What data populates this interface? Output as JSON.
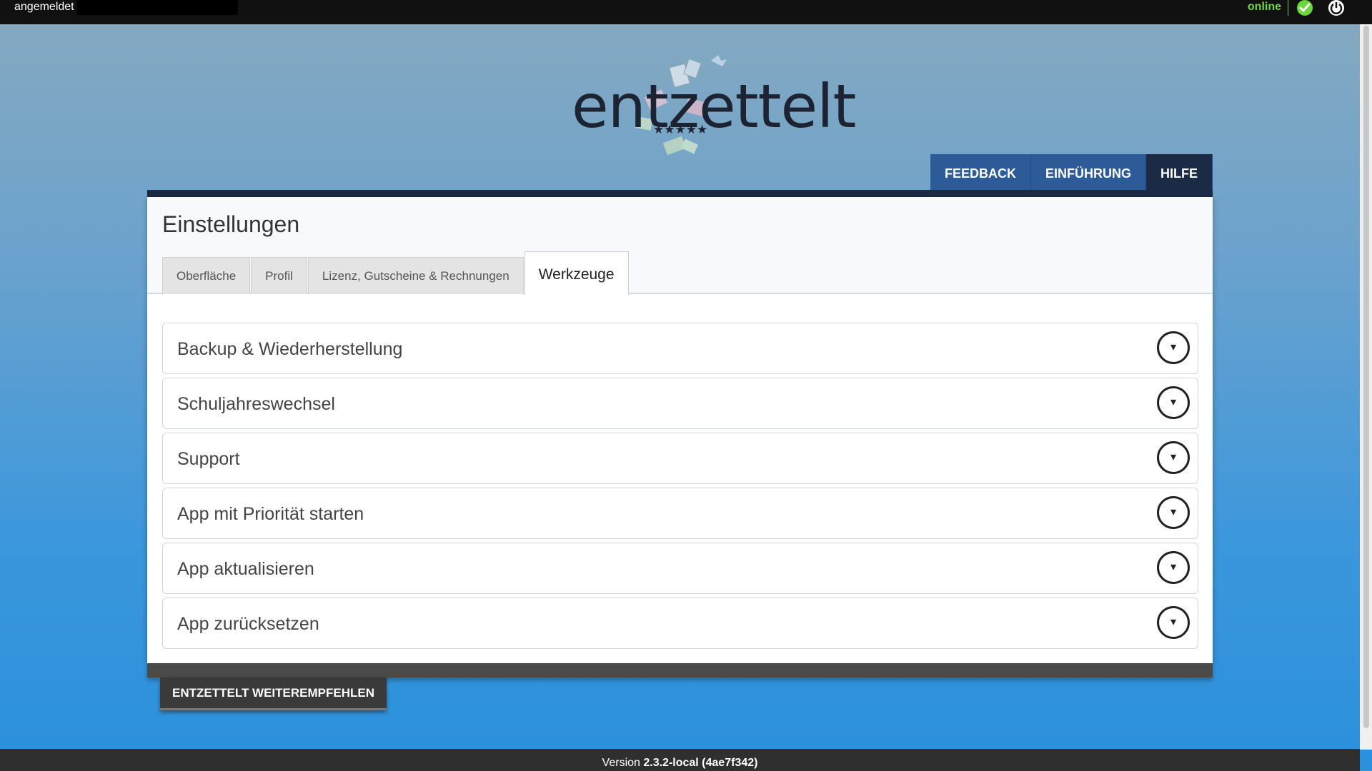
{
  "topbar": {
    "user_status": "angemeldet",
    "connection": "online",
    "check_icon": "check-circle-icon",
    "power_icon": "power-icon",
    "status_color": "#6bd63e"
  },
  "logo": {
    "text": "entzettelt",
    "stars": "★★★★★"
  },
  "nav": {
    "tabs": [
      {
        "label": "FEEDBACK"
      },
      {
        "label": "EINFÜHRUNG"
      },
      {
        "label": "HILFE"
      }
    ],
    "active": "HILFE"
  },
  "settings": {
    "title": "Einstellungen",
    "tabs": [
      {
        "label": "Oberfläche"
      },
      {
        "label": "Profil"
      },
      {
        "label": "Lizenz, Gutscheine & Rechnungen"
      },
      {
        "label": "Werkzeuge"
      }
    ],
    "active_tab": "Werkzeuge",
    "panels": [
      {
        "label": "Backup & Wiederherstellung",
        "toggle": "▾"
      },
      {
        "label": "Schuljahreswechsel",
        "toggle": "▾"
      },
      {
        "label": "Support",
        "toggle": "▾"
      },
      {
        "label": "App mit Priorität starten",
        "toggle": "▾"
      },
      {
        "label": "App aktualisieren",
        "toggle": "▾"
      },
      {
        "label": "App zurücksetzen",
        "toggle": "▾"
      }
    ]
  },
  "recommend_button": "ENTZETTELT WEITEREMPFEHLEN",
  "footer": {
    "prefix": "Version",
    "version": "2.3.2-local (4ae7f342)"
  },
  "colors": {
    "accent": "#2d5b98",
    "dark": "#1b2b45"
  }
}
